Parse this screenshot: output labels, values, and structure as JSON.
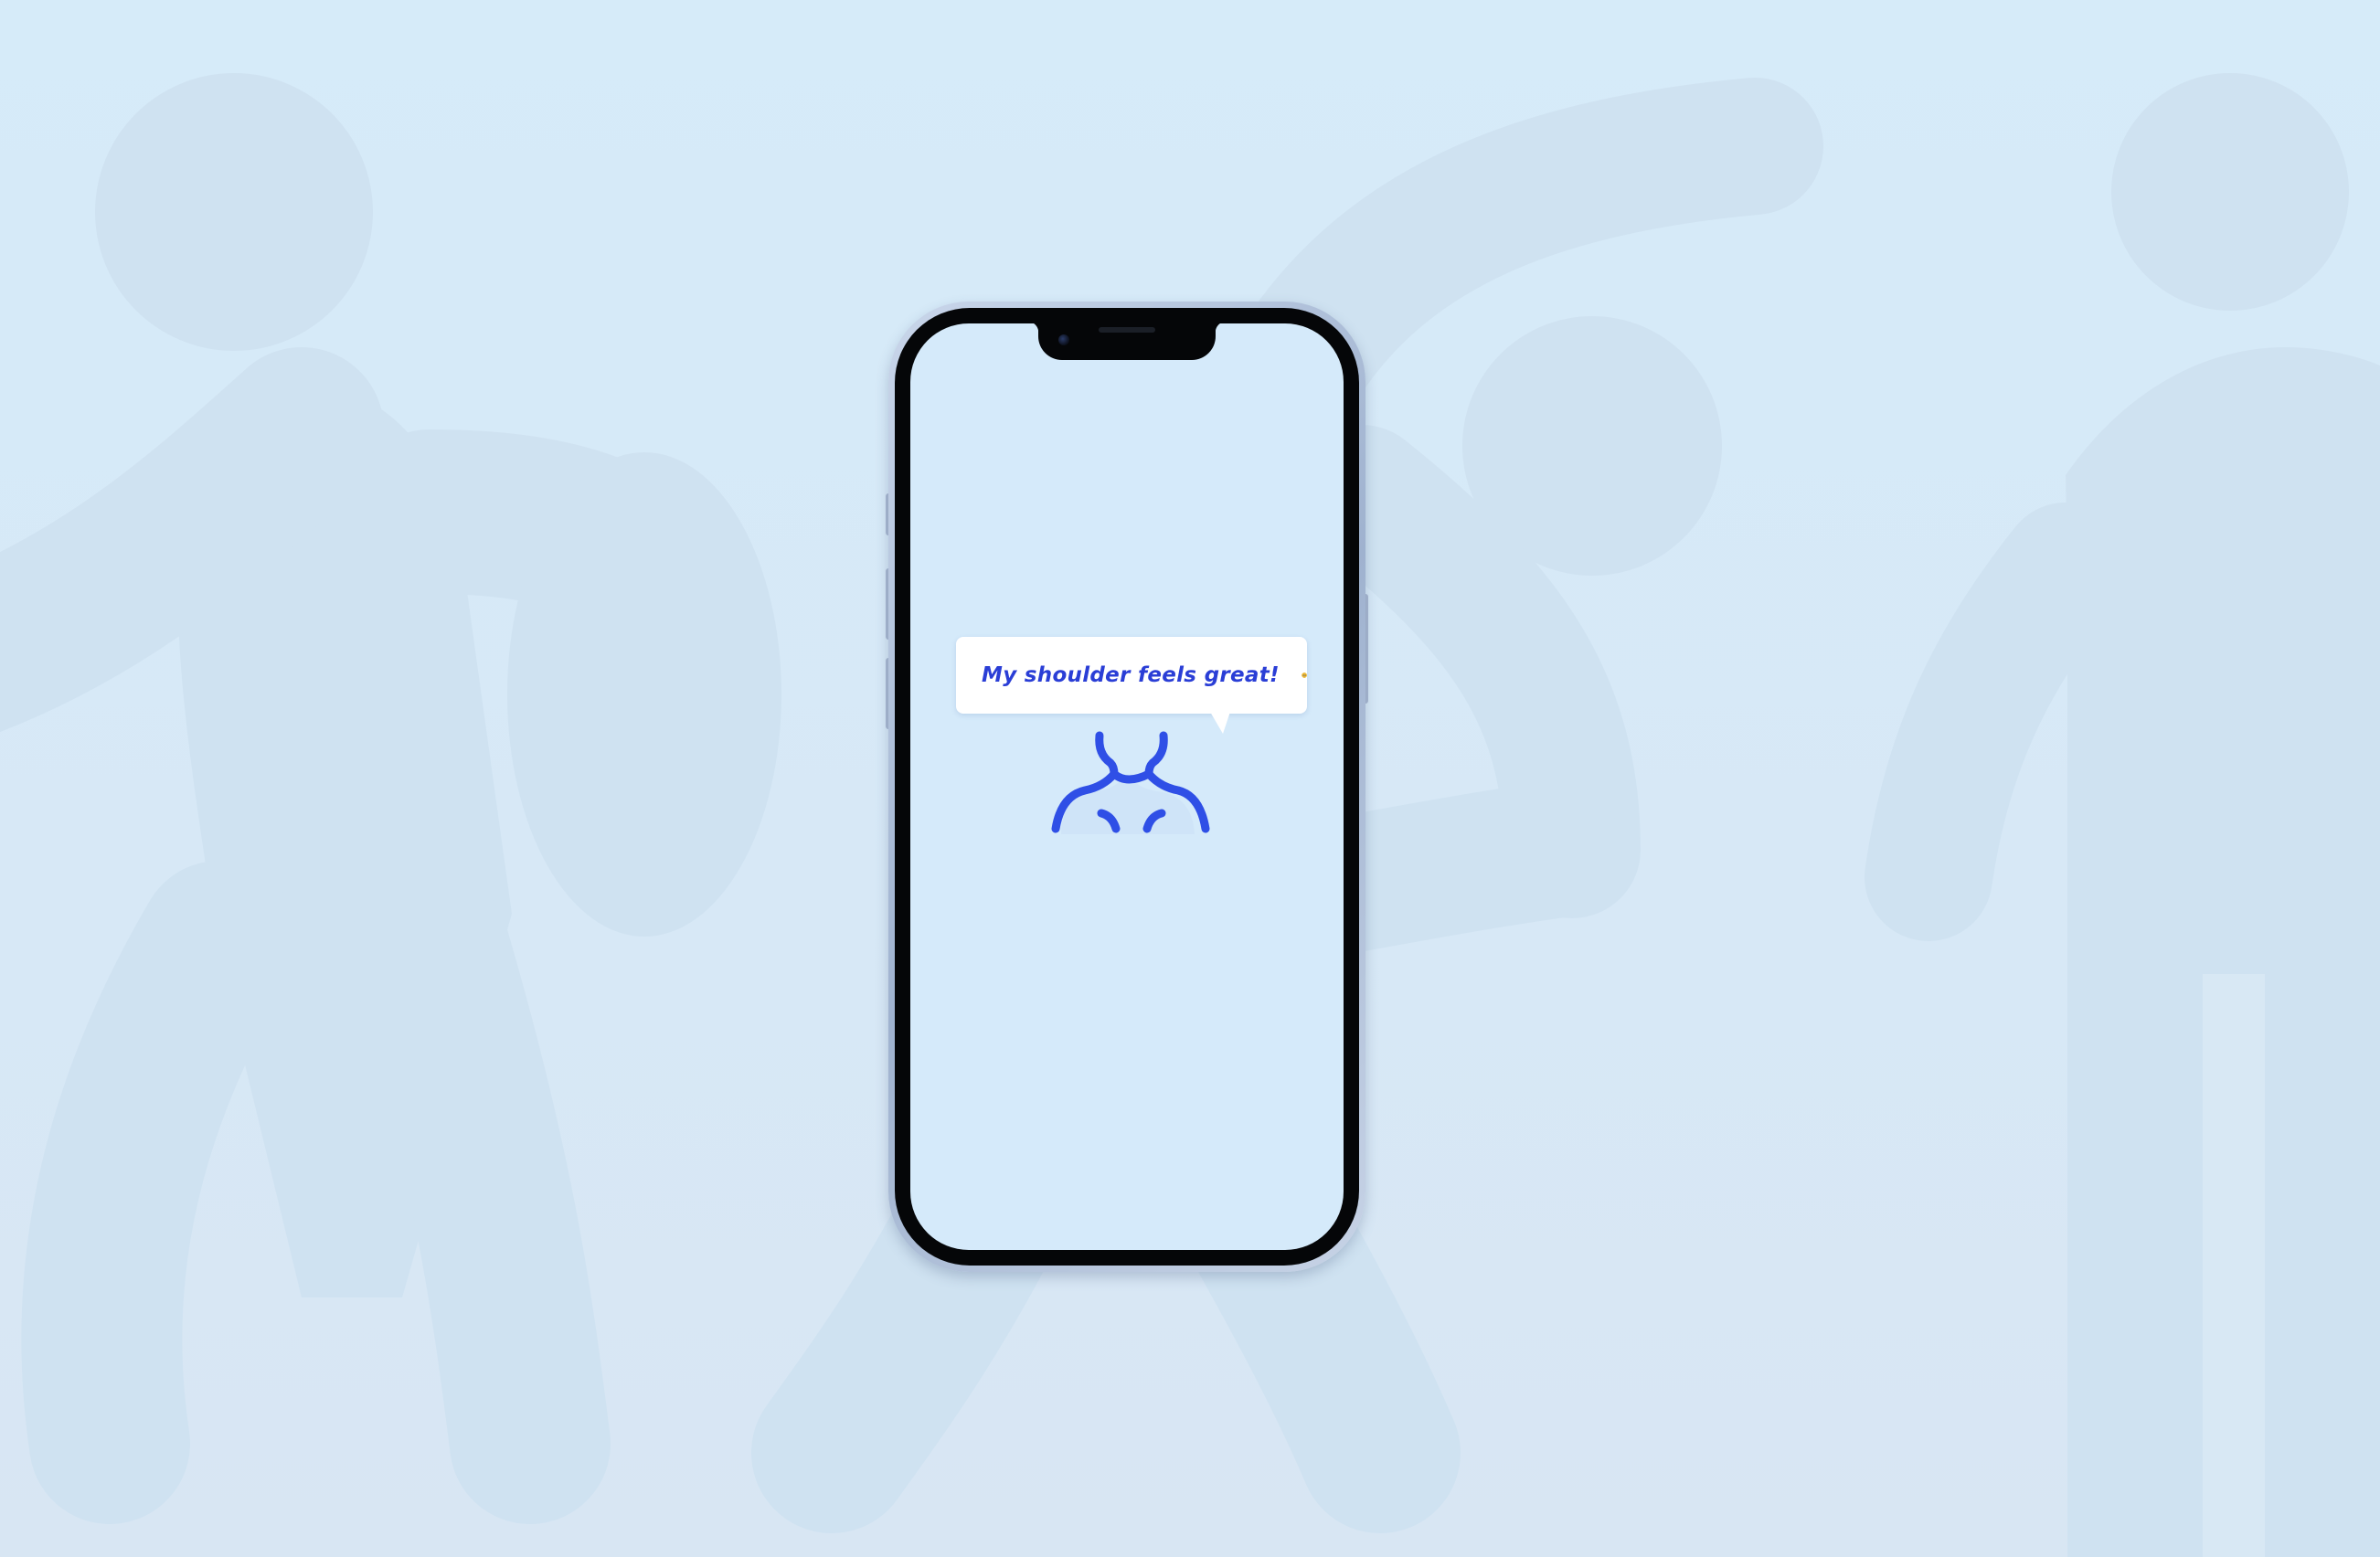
{
  "scene": {
    "background_color": "#d6ebf9",
    "figure_color": "#cfe2f1"
  },
  "phone": {
    "frame_color": "#a9bad3",
    "screen_color": "#d5eafa"
  },
  "speech_bubble": {
    "text": "My shoulder feels great!",
    "emoji_icon": "grinning-face-icon",
    "text_color": "#2a3ed6"
  },
  "body_icon": {
    "icon": "upper-body-shoulder-icon",
    "color": "#2f4fe6"
  }
}
